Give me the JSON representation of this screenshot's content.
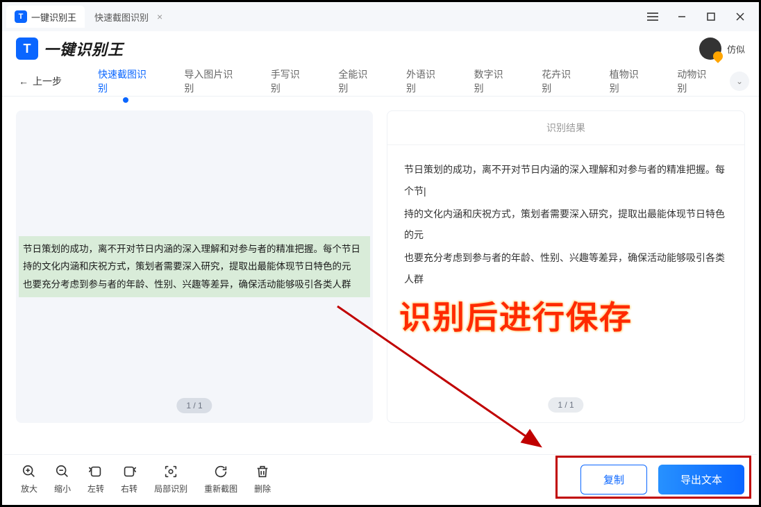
{
  "titlebar": {
    "tab1": "一键识别王",
    "tab2": "快速截图识别"
  },
  "header": {
    "brand": "一键识别王",
    "username": "仿似"
  },
  "nav": {
    "back": "上一步",
    "tabs": [
      "快速截图识别",
      "导入图片识别",
      "手写识别",
      "全能识别",
      "外语识别",
      "数字识别",
      "花卉识别",
      "植物识别",
      "动物识别"
    ]
  },
  "preview": {
    "text_lines": [
      "节日策划的成功，离不开对节日内涵的深入理解和对参与者的精准把握。每个节日",
      "持的文化内涵和庆祝方式，策划者需要深入研究，提取出最能体现节日特色的元",
      "也要充分考虑到参与者的年龄、性别、兴趣等差异，确保活动能够吸引各类人群"
    ],
    "pager": "1 / 1"
  },
  "result": {
    "header": "识别结果",
    "lines": [
      "节日策划的成功，离不开对节日内涵的深入理解和对参与者的精准把握。每个节|",
      "持的文化内涵和庆祝方式，策划者需要深入研究，提取出最能体现节日特色的元",
      "也要充分考虑到参与者的年龄、性别、兴趣等差异，确保活动能够吸引各类人群"
    ],
    "pager": "1 / 1"
  },
  "tools": {
    "zoom_in": "放大",
    "zoom_out": "缩小",
    "rotate_left": "左转",
    "rotate_right": "右转",
    "region": "局部识别",
    "recapture": "重新截图",
    "delete": "删除"
  },
  "actions": {
    "copy": "复制",
    "export": "导出文本"
  },
  "annotation": "识别后进行保存"
}
